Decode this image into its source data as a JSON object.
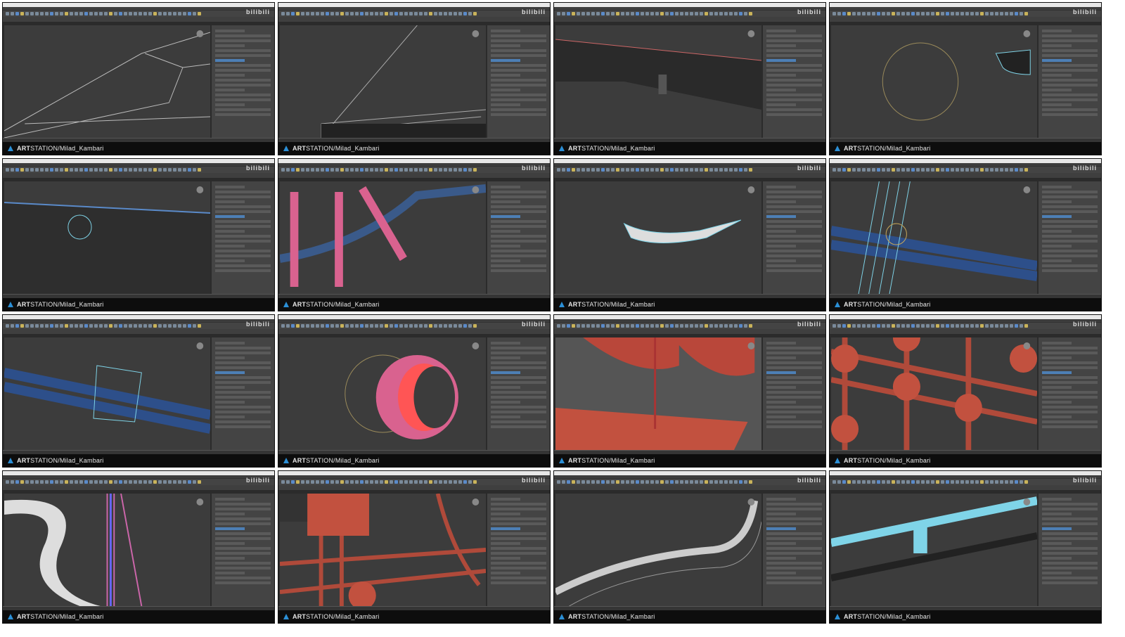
{
  "sheet": {
    "watermark_brand": "ART",
    "watermark_rest": "STATION/Milad_Kambari",
    "overlay_logo": "bilibili",
    "panel_count": 16,
    "colors": {
      "viewport": "#3c3c3c",
      "selection": "#7fd4e8",
      "model_red": "#c2513f",
      "pink": "#d9628f",
      "watermark_bg": "#0d0d0d"
    }
  }
}
